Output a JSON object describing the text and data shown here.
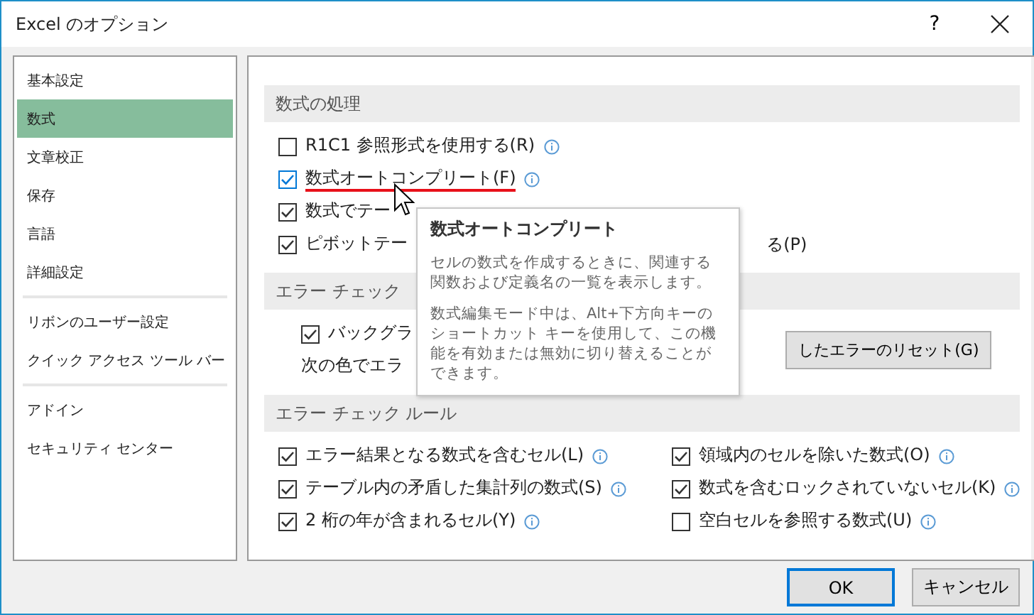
{
  "window": {
    "title": "Excel のオプション",
    "help": "?"
  },
  "sidebar": {
    "groups": [
      [
        {
          "label": "基本設定",
          "selected": false
        },
        {
          "label": "数式",
          "selected": true
        },
        {
          "label": "文章校正",
          "selected": false
        },
        {
          "label": "保存",
          "selected": false
        },
        {
          "label": "言語",
          "selected": false
        },
        {
          "label": "詳細設定",
          "selected": false
        }
      ],
      [
        {
          "label": "リボンのユーザー設定",
          "selected": false
        },
        {
          "label": "クイック アクセス ツール バー",
          "selected": false
        }
      ],
      [
        {
          "label": "アドイン",
          "selected": false
        },
        {
          "label": "セキュリティ センター",
          "selected": false
        }
      ]
    ]
  },
  "sections": [
    {
      "title": "数式の処理",
      "rows": [
        {
          "kind": "checkbox",
          "label": "R1C1 参照形式を使用する(R)",
          "checked": false,
          "info": true,
          "hovered": false
        },
        {
          "kind": "checkbox",
          "label": "数式オートコンプリート(F)",
          "checked": true,
          "info": true,
          "hovered": true
        },
        {
          "kind": "checkbox",
          "label": "数式でテー",
          "checked": true,
          "hovered": false
        },
        {
          "kind": "checkbox",
          "label": "ピボットテー",
          "tail": "る(P)",
          "checked": true,
          "hovered": false
        }
      ]
    },
    {
      "title": "エラー チェック",
      "rows": [
        {
          "kind": "sub-checkbox",
          "label": "バックグラ",
          "checked": true,
          "hovered": false
        },
        {
          "kind": "button-row",
          "label": "次の色でエラ",
          "button": "したエラーのリセット(G)"
        }
      ]
    },
    {
      "title": "エラー チェック ルール",
      "columns": [
        [
          {
            "label": "エラー結果となる数式を含むセル(L)",
            "checked": true
          },
          {
            "label": "テーブル内の矛盾した集計列の数式(S)",
            "checked": true
          },
          {
            "label": "2 桁の年が含まれるセル(Y)",
            "checked": true
          }
        ],
        [
          {
            "label": "領域内のセルを除いた数式(O)",
            "checked": true
          },
          {
            "label": "数式を含むロックされていないセル(K)",
            "checked": true
          },
          {
            "label": "空白セルを参照する数式(U)",
            "checked": false
          }
        ]
      ]
    }
  ],
  "tooltip": {
    "title": "数式オートコンプリート",
    "paragraphs": [
      "セルの数式を作成するときに、関連する関数および定義名の一覧を表示します。",
      "数式編集モード中は、Alt+下方向キーのショートカット キーを使用して、この機能を有効または無効に切り替えることができます。"
    ]
  },
  "buttons": [
    {
      "label": "OK",
      "default": true
    },
    {
      "label": "キャンセル",
      "default": false
    }
  ]
}
